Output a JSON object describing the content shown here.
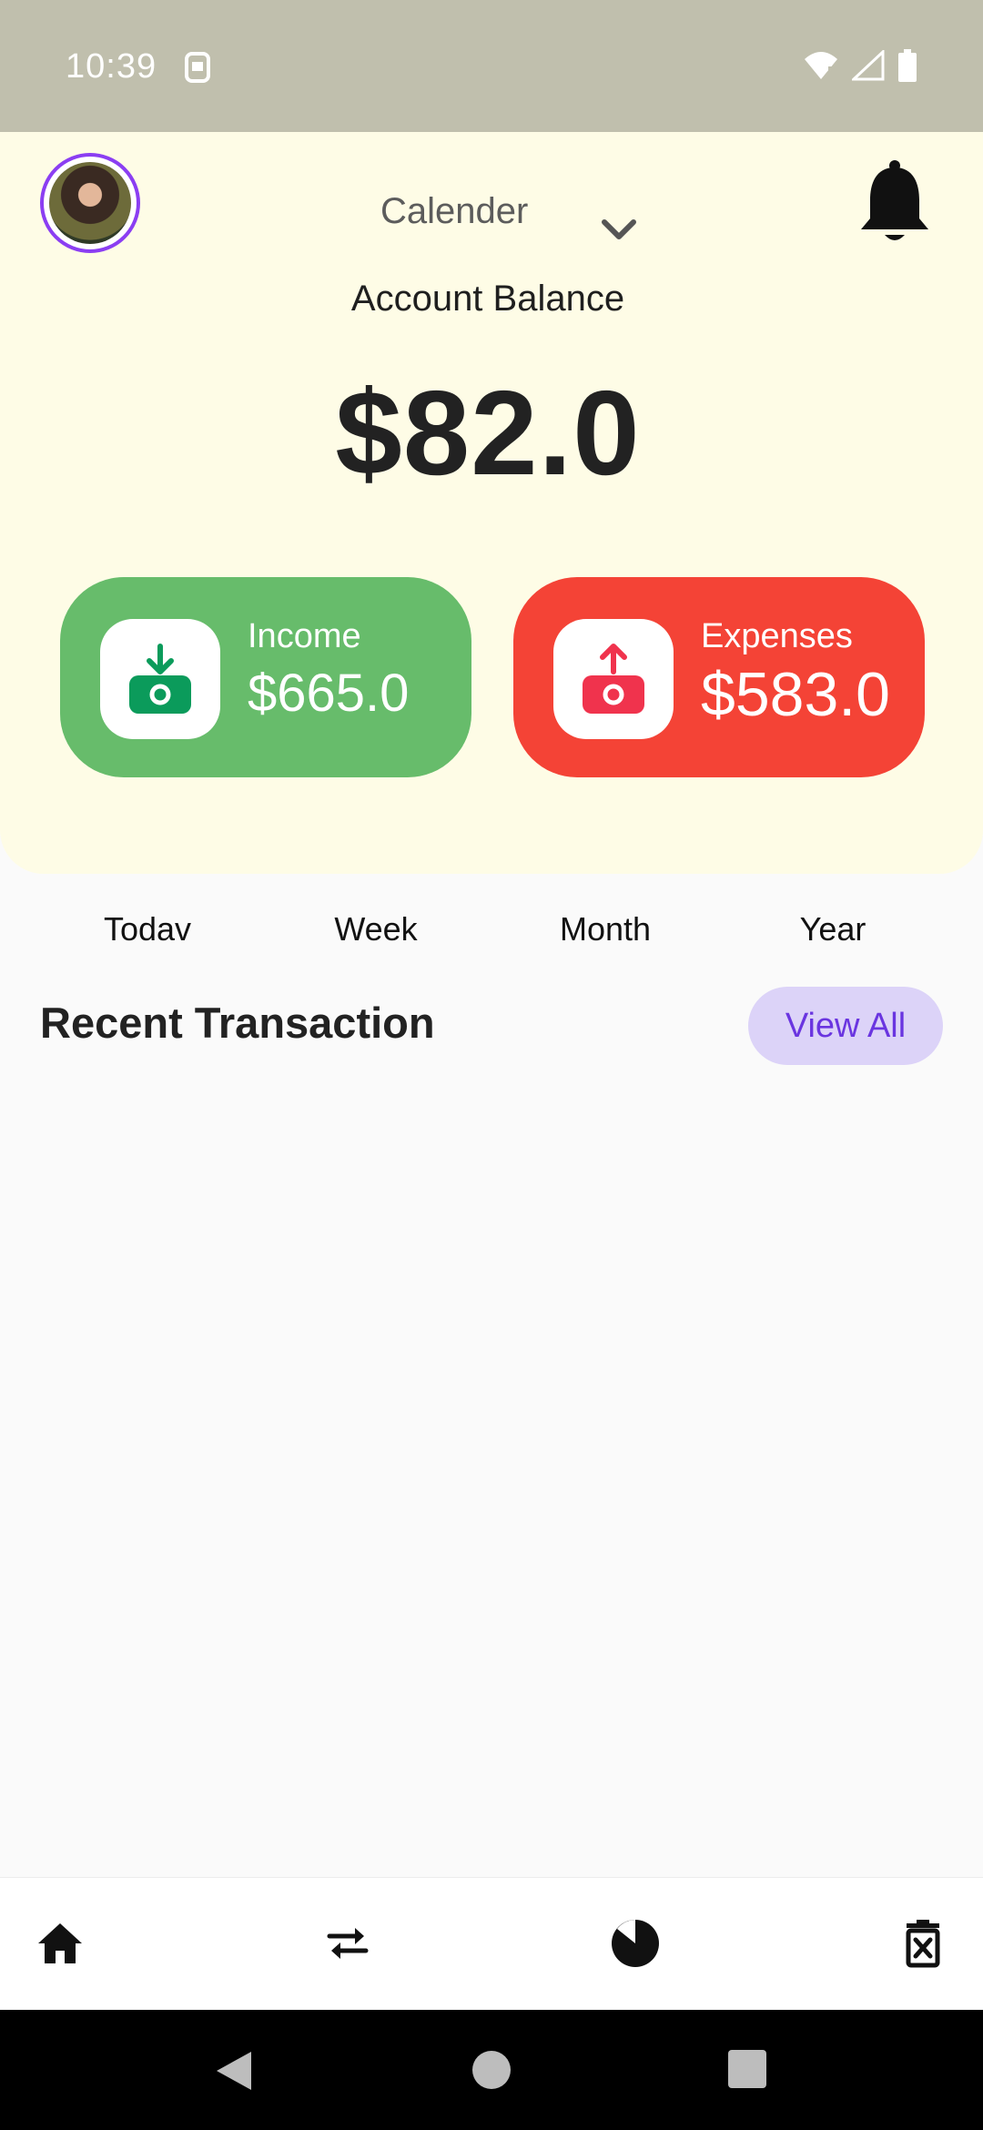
{
  "status_bar": {
    "time": "10:39"
  },
  "header": {
    "calendar_label": "Calender",
    "balance_label": "Account Balance",
    "balance_amount": "$82.0"
  },
  "cards": {
    "income": {
      "label": "Income",
      "value": "$665.0",
      "color": "#67bc6b"
    },
    "expenses": {
      "label": "Expenses",
      "value": "$583.0",
      "color": "#f44336"
    }
  },
  "range_tabs": [
    "Todav",
    "Week",
    "Month",
    "Year"
  ],
  "recent": {
    "title": "Recent Transaction",
    "view_all_label": "View All"
  },
  "bottom_nav": [
    "home-icon",
    "transfer-icon",
    "pie-chart-icon",
    "delete-icon"
  ],
  "colors": {
    "header_bg": "#fefce6",
    "accent": "#8b3ef2",
    "view_all_bg": "#dcd3f8",
    "view_all_text": "#6a35e0"
  }
}
